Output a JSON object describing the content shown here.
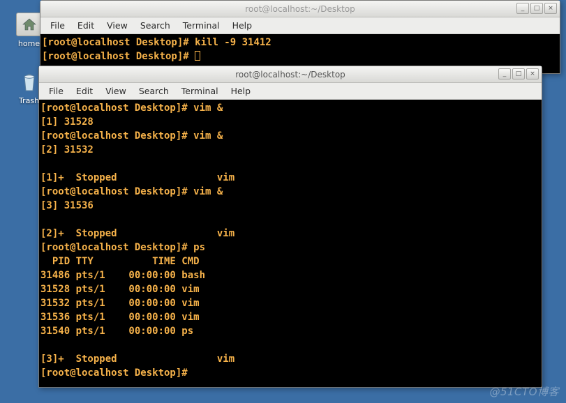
{
  "desktop": {
    "icons": [
      {
        "name": "home",
        "label": "home"
      },
      {
        "name": "trash",
        "label": "Trash"
      }
    ]
  },
  "menus": {
    "file": "File",
    "edit": "Edit",
    "view": "View",
    "search": "Search",
    "terminal": "Terminal",
    "help": "Help"
  },
  "window_back": {
    "title": "root@localhost:~/Desktop",
    "lines": [
      {
        "prompt": "[root@localhost Desktop]# ",
        "cmd": "kill -9 31412"
      },
      {
        "prompt": "[root@localhost Desktop]# ",
        "cmd": "",
        "cursor": true
      }
    ],
    "btn_min": "_",
    "btn_max": "□",
    "btn_close": "×"
  },
  "window_front": {
    "title": "root@localhost:~/Desktop",
    "lines": [
      {
        "prompt": "[root@localhost Desktop]# ",
        "cmd": "vim &"
      },
      {
        "text": "[1] 31528"
      },
      {
        "prompt": "[root@localhost Desktop]# ",
        "cmd": "vim &"
      },
      {
        "text": "[2] 31532"
      },
      {
        "text": ""
      },
      {
        "text": "[1]+  Stopped                 vim"
      },
      {
        "prompt": "[root@localhost Desktop]# ",
        "cmd": "vim &"
      },
      {
        "text": "[3] 31536"
      },
      {
        "text": ""
      },
      {
        "text": "[2]+  Stopped                 vim"
      },
      {
        "prompt": "[root@localhost Desktop]# ",
        "cmd": "ps"
      },
      {
        "text": "  PID TTY          TIME CMD"
      },
      {
        "text": "31486 pts/1    00:00:00 bash"
      },
      {
        "text": "31528 pts/1    00:00:00 vim"
      },
      {
        "text": "31532 pts/1    00:00:00 vim"
      },
      {
        "text": "31536 pts/1    00:00:00 vim"
      },
      {
        "text": "31540 pts/1    00:00:00 ps"
      },
      {
        "text": ""
      },
      {
        "text": "[3]+  Stopped                 vim"
      },
      {
        "prompt": "[root@localhost Desktop]# ",
        "cmd": ""
      }
    ],
    "btn_min": "_",
    "btn_max": "□",
    "btn_close": "×"
  },
  "watermark": "@51CTO博客"
}
